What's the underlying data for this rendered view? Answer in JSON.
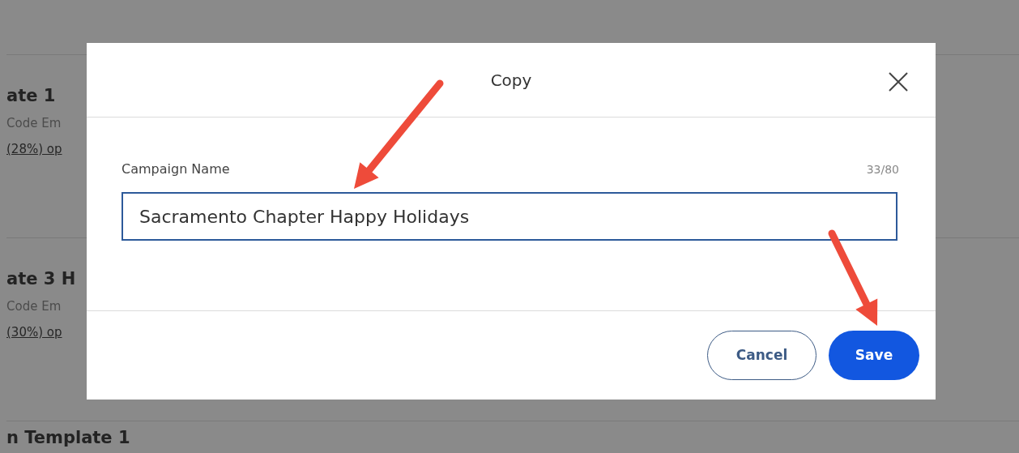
{
  "background_list": [
    {
      "title": "ate 1",
      "subtitle": "Code Em",
      "stats": "(28%) op"
    },
    {
      "title": "ate 3 H",
      "subtitle": "Code Em",
      "stats": "(30%) op"
    },
    {
      "title": "n Template 1"
    }
  ],
  "dialog": {
    "title": "Copy",
    "field": {
      "label": "Campaign Name",
      "counter": "33/80",
      "value": "Sacramento Chapter Happy Holidays",
      "focused": true
    },
    "buttons": [
      {
        "label": "Cancel",
        "kind": "secondary"
      },
      {
        "label": "Save",
        "kind": "primary"
      }
    ]
  },
  "annotations": [
    {
      "kind": "arrow"
    },
    {
      "kind": "arrow"
    }
  ]
}
